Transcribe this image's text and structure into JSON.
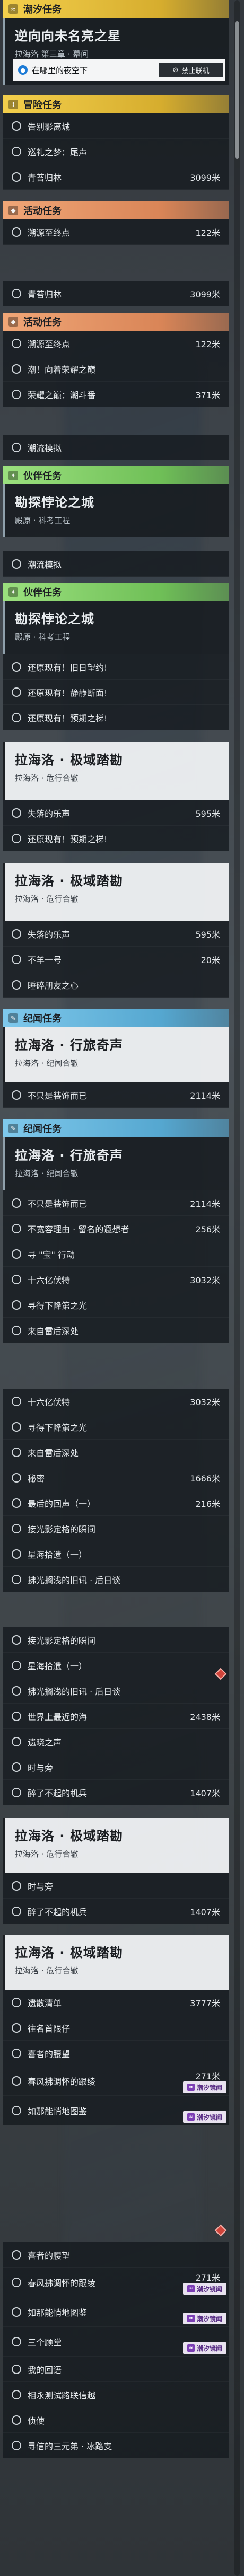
{
  "sections": {
    "tracked": "潮汐任务",
    "main": "冒险任务",
    "activity": "活动任务",
    "companion": "伙伴任务",
    "region": "纪闻任务"
  },
  "pinned_quest": {
    "title": "逆向向未名亮之星",
    "subtitle": "拉海洛 第三章 · 幕间",
    "action": "在哪里的夜空下",
    "action_right": "禁止联机"
  },
  "main_rows": [
    {
      "label": "告别影离城",
      "meta": ""
    },
    {
      "label": "巡礼之梦：尾声",
      "meta": ""
    },
    {
      "label": "青苔归林",
      "meta": "3099米"
    }
  ],
  "activity_rows_1": [
    {
      "label": "溯源至终点",
      "meta": "122米"
    },
    {
      "label": "青苔归林",
      "meta": "3099米"
    }
  ],
  "activity_rows_2": [
    {
      "label": "溯源至终点",
      "meta": "122米"
    },
    {
      "label": "潮！向着荣耀之巅",
      "meta": ""
    },
    {
      "label": "荣耀之巅：潮斗番",
      "meta": "371米"
    }
  ],
  "activity_plain_1": "潮流模拟",
  "companion_card": {
    "title": "勘探悖论之城",
    "subtitle": "殿原 · 科考工程"
  },
  "companion_plain": "潮流模拟",
  "companion_card_2": {
    "title": "勘探悖论之城",
    "subtitle": "殿原 · 科考工程"
  },
  "companion_rows": [
    {
      "label": "还原现有！旧日望约!",
      "meta": ""
    },
    {
      "label": "还原现有！静静断面!",
      "meta": ""
    },
    {
      "label": "还原现有！预期之梯!",
      "meta": ""
    }
  ],
  "card_a": {
    "title": "拉海洛 · 极域踏勘",
    "subtitle": "拉海洛 · 危行合辙"
  },
  "rows_a": [
    {
      "label": "失落的乐声",
      "meta": "595米"
    },
    {
      "label": "还原现有！预期之梯!",
      "meta": ""
    }
  ],
  "card_b": {
    "title": "拉海洛 · 极域踏勘",
    "subtitle": "拉海洛 · 危行合辙"
  },
  "rows_b": [
    {
      "label": "失落的乐声",
      "meta": "595米"
    },
    {
      "label": "不羊一号",
      "meta": "20米"
    },
    {
      "label": "睡碎朋友之心",
      "meta": ""
    }
  ],
  "card_c": {
    "title": "拉海洛 · 行旅奇声",
    "subtitle": "拉海洛 · 纪闻合辙"
  },
  "rows_c": [
    {
      "label": "不只是装饰而已",
      "meta": "2114米"
    }
  ],
  "card_d": {
    "title": "拉海洛 · 行旅奇声",
    "subtitle": "拉海洛 · 纪闻合辙"
  },
  "rows_d": [
    {
      "label": "不只是装饰而已",
      "meta": "2114米"
    },
    {
      "label": "不宽容理由 · 留名的遐想者",
      "meta": "256米"
    },
    {
      "label": "寻 \"宝\" 行动",
      "meta": ""
    },
    {
      "label": "十六亿伏特",
      "meta": "3032米"
    },
    {
      "label": "寻得下降第之光",
      "meta": ""
    },
    {
      "label": "来自雷后深处",
      "meta": ""
    }
  ],
  "rows_e": [
    {
      "label": "十六亿伏特",
      "meta": "3032米"
    },
    {
      "label": "寻得下降第之光",
      "meta": ""
    },
    {
      "label": "来自雷后深处",
      "meta": ""
    },
    {
      "label": "秘密",
      "meta": "1666米"
    },
    {
      "label": "最后的回声（一）",
      "meta": "216米"
    },
    {
      "label": "接光影定格的瞬间",
      "meta": ""
    },
    {
      "label": "星海拾遗（一）",
      "meta": ""
    },
    {
      "label": "拂光搁浅的旧讯 · 后日谈",
      "meta": ""
    }
  ],
  "rows_f": [
    {
      "label": "接光影定格的瞬间",
      "meta": ""
    },
    {
      "label": "星海拾遗（一）",
      "meta": ""
    },
    {
      "label": "拂光搁浅的旧讯 · 后日谈",
      "meta": ""
    },
    {
      "label": "世界上最近的海",
      "meta": "2438米"
    },
    {
      "label": "遗晓之声",
      "meta": ""
    },
    {
      "label": "时与旁",
      "meta": ""
    },
    {
      "label": "醉了不起的机兵",
      "meta": "1407米"
    }
  ],
  "card_g": {
    "title": "拉海洛 · 极域踏勘",
    "subtitle": "拉海洛 · 危行合辙"
  },
  "rows_g": [
    {
      "label": "时与旁",
      "meta": ""
    },
    {
      "label": "醉了不起的机兵",
      "meta": "1407米"
    }
  ],
  "card_h": {
    "title": "拉海洛 · 极域踏勘",
    "subtitle": "拉海洛 · 危行合辙"
  },
  "rows_h": [
    {
      "label": "遗散清单",
      "meta": "3777米"
    },
    {
      "label": "往名首限仔",
      "meta": ""
    },
    {
      "label": "喜者的腰望",
      "meta": ""
    },
    {
      "label": "春风拂调怀的跟绫",
      "meta": "271米",
      "badge": "潮汐镜闻"
    },
    {
      "label": "如那能悄地图鉴",
      "meta": "",
      "badge": "潮汐镜闻"
    }
  ],
  "rows_i": [
    {
      "label": "喜者的腰望",
      "meta": ""
    },
    {
      "label": "春风拂调怀的跟绫",
      "meta": "271米",
      "badge": "潮汐镜闻"
    },
    {
      "label": "如那能悄地图鉴",
      "meta": "",
      "badge": "潮汐镜闻"
    },
    {
      "label": "三个顾堂",
      "meta": "",
      "badge": "潮汐镜闻"
    },
    {
      "label": "我的回语",
      "meta": ""
    },
    {
      "label": "相永测试路联信越",
      "meta": ""
    },
    {
      "label": "侦使",
      "meta": ""
    },
    {
      "label": "寻信的三元弟 · 冰路支",
      "meta": ""
    }
  ]
}
